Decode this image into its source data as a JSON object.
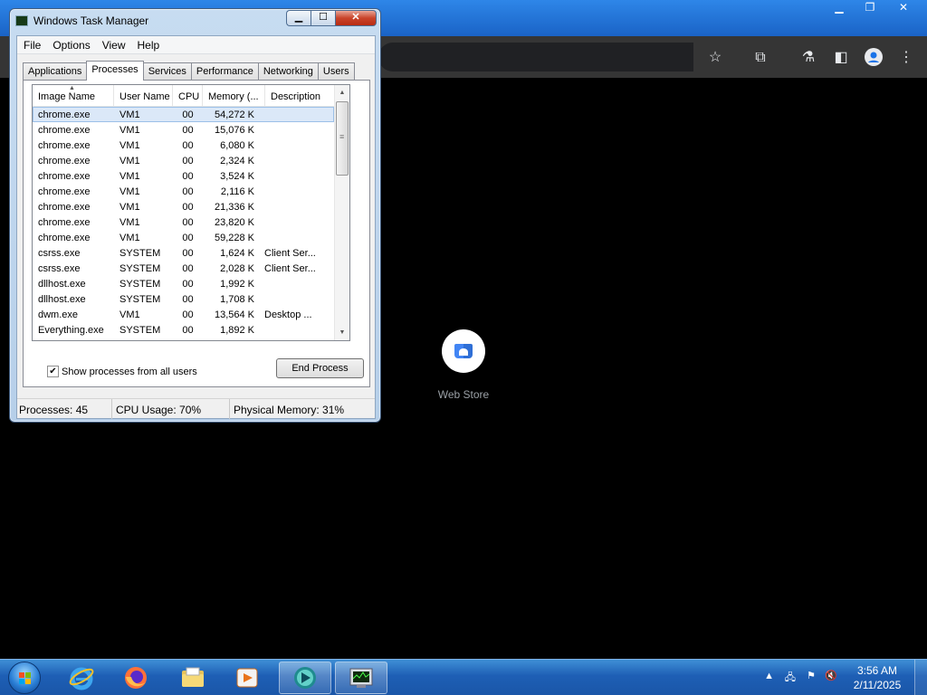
{
  "browser": {
    "web_store_label": "Web Store"
  },
  "task_manager": {
    "title": "Windows Task Manager",
    "menu": [
      "File",
      "Options",
      "View",
      "Help"
    ],
    "tabs": [
      "Applications",
      "Processes",
      "Services",
      "Performance",
      "Networking",
      "Users"
    ],
    "active_tab": "Processes",
    "columns": [
      "Image Name",
      "User Name",
      "CPU",
      "Memory (...",
      "Description"
    ],
    "processes": [
      {
        "name": "chrome.exe",
        "user": "VM1",
        "cpu": "00",
        "memory": "54,272 K",
        "description": ""
      },
      {
        "name": "chrome.exe",
        "user": "VM1",
        "cpu": "00",
        "memory": "15,076 K",
        "description": ""
      },
      {
        "name": "chrome.exe",
        "user": "VM1",
        "cpu": "00",
        "memory": "6,080 K",
        "description": ""
      },
      {
        "name": "chrome.exe",
        "user": "VM1",
        "cpu": "00",
        "memory": "2,324 K",
        "description": ""
      },
      {
        "name": "chrome.exe",
        "user": "VM1",
        "cpu": "00",
        "memory": "3,524 K",
        "description": ""
      },
      {
        "name": "chrome.exe",
        "user": "VM1",
        "cpu": "00",
        "memory": "2,116 K",
        "description": ""
      },
      {
        "name": "chrome.exe",
        "user": "VM1",
        "cpu": "00",
        "memory": "21,336 K",
        "description": ""
      },
      {
        "name": "chrome.exe",
        "user": "VM1",
        "cpu": "00",
        "memory": "23,820 K",
        "description": ""
      },
      {
        "name": "chrome.exe",
        "user": "VM1",
        "cpu": "00",
        "memory": "59,228 K",
        "description": ""
      },
      {
        "name": "csrss.exe",
        "user": "SYSTEM",
        "cpu": "00",
        "memory": "1,624 K",
        "description": "Client Ser..."
      },
      {
        "name": "csrss.exe",
        "user": "SYSTEM",
        "cpu": "00",
        "memory": "2,028 K",
        "description": "Client Ser..."
      },
      {
        "name": "dllhost.exe",
        "user": "SYSTEM",
        "cpu": "00",
        "memory": "1,992 K",
        "description": ""
      },
      {
        "name": "dllhost.exe",
        "user": "SYSTEM",
        "cpu": "00",
        "memory": "1,708 K",
        "description": ""
      },
      {
        "name": "dwm.exe",
        "user": "VM1",
        "cpu": "00",
        "memory": "13,564 K",
        "description": "Desktop ..."
      },
      {
        "name": "Everything.exe",
        "user": "SYSTEM",
        "cpu": "00",
        "memory": "1,892 K",
        "description": ""
      }
    ],
    "selected_row": 0,
    "show_all_users_label": "Show processes from all users",
    "show_all_users_checked": true,
    "end_process_label": "End Process",
    "status": {
      "processes": "Processes: 45",
      "cpu": "CPU Usage: 70%",
      "memory": "Physical Memory: 31%"
    }
  },
  "taskbar": {
    "pinned": [
      "start-orb",
      "internet-explorer-icon",
      "firefox-icon",
      "file-explorer-icon",
      "media-player-icon",
      "app-icon",
      "task-manager-icon"
    ],
    "clock": {
      "time": "3:56 AM",
      "date": "2/11/2025"
    }
  },
  "colors": {
    "taskbar": "#1e5fb5",
    "selection": "#dbe8f8",
    "chrome_toolbar": "#353535"
  }
}
